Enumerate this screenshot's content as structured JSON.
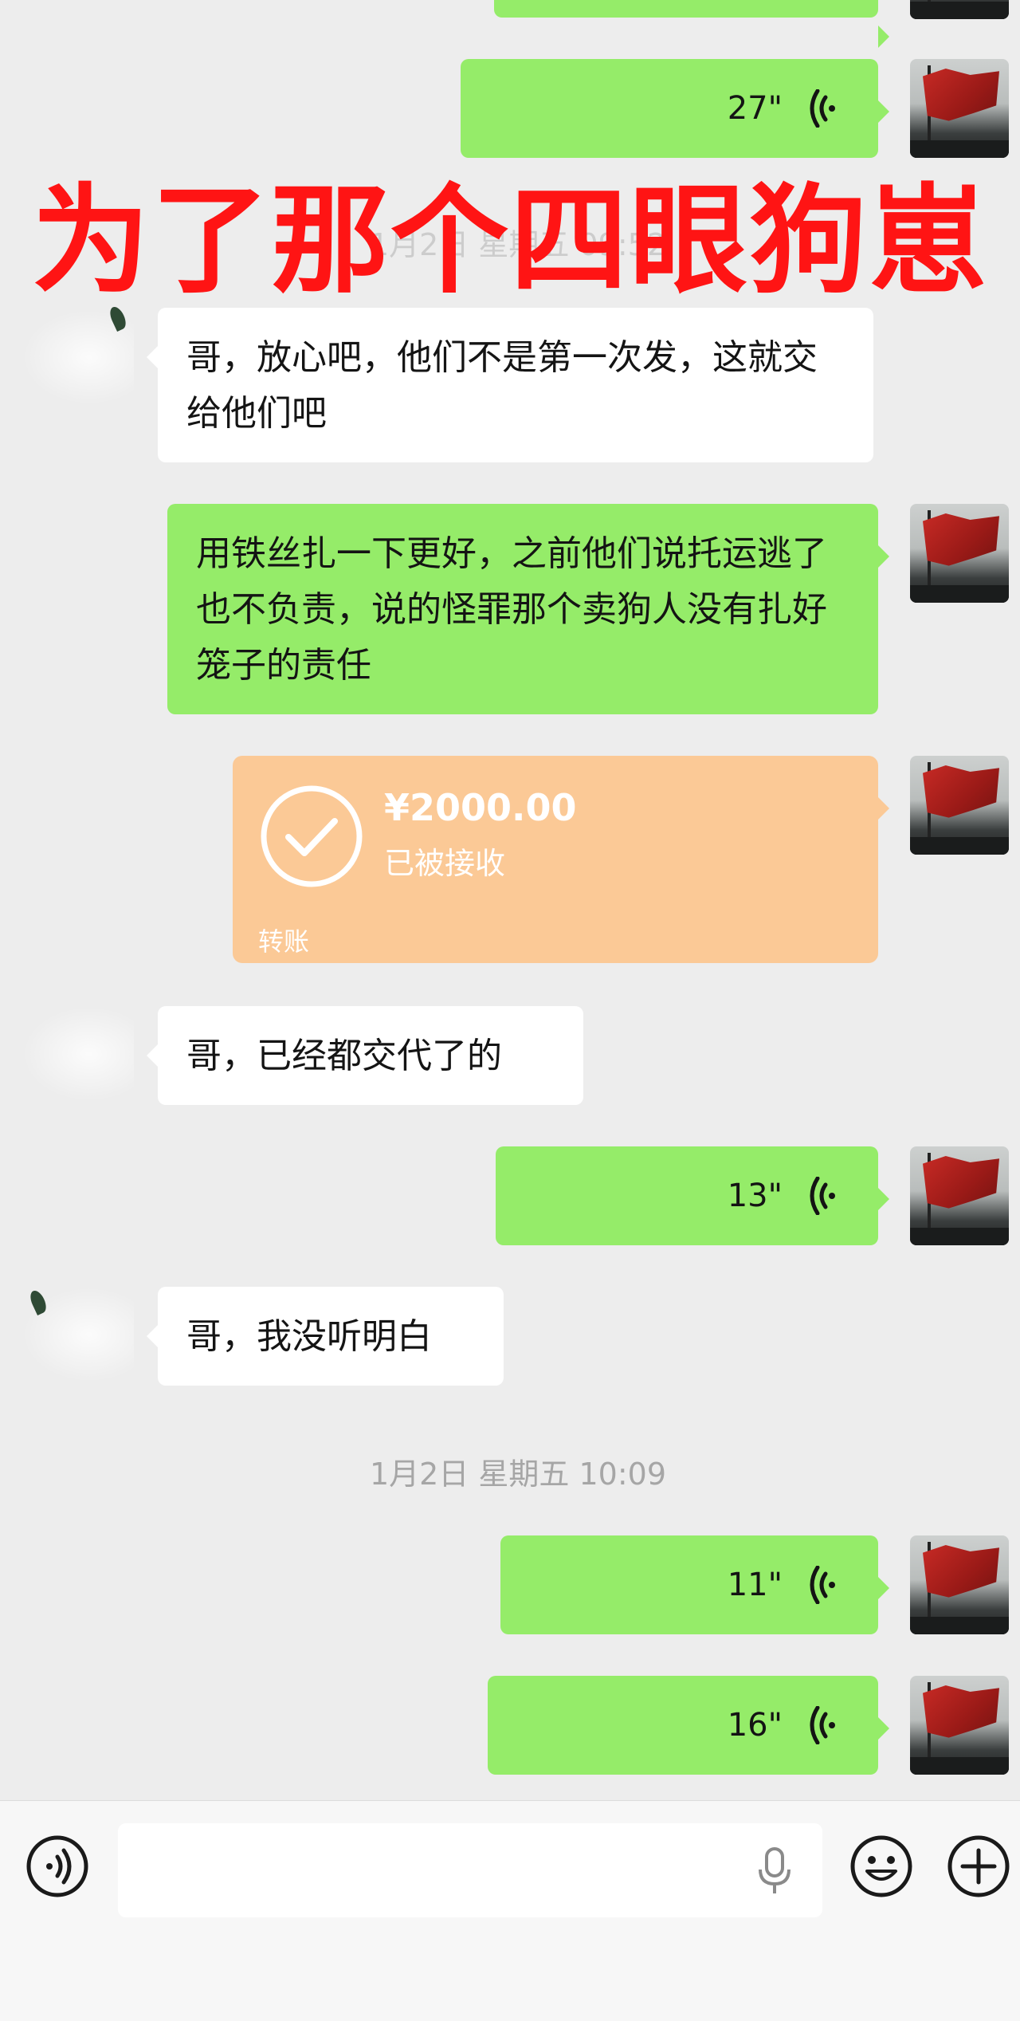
{
  "overlay": {
    "title": "为了那个四眼狗崽"
  },
  "timestamps": {
    "faded": "1月2日 星期五 09:52",
    "second": "1月2日 星期五 10:09"
  },
  "messages": {
    "voice_27": "27\"",
    "white_1": "哥，放心吧，他们不是第一次发，这就交给他们吧",
    "green_1": "用铁丝扎一下更好，之前他们说托运逃了也不负责，说的怪罪那个卖狗人没有扎好笼子的责任",
    "transfer": {
      "amount": "¥2000.00",
      "status": "已被接收",
      "kind": "转账"
    },
    "white_2": "哥，已经都交代了的",
    "voice_13": "13\"",
    "white_3": "哥，我没听明白",
    "voice_11": "11\"",
    "voice_16": "16\""
  },
  "colors": {
    "self_bubble": "#95ec69",
    "other_bubble": "#ffffff",
    "transfer": "#fbc996",
    "overlay_text": "#ff1414",
    "background": "#ededed"
  },
  "icons": [
    "voice-wave-icon",
    "check-circle-icon",
    "voice-input-icon",
    "microphone-icon",
    "emoji-icon",
    "plus-icon"
  ]
}
